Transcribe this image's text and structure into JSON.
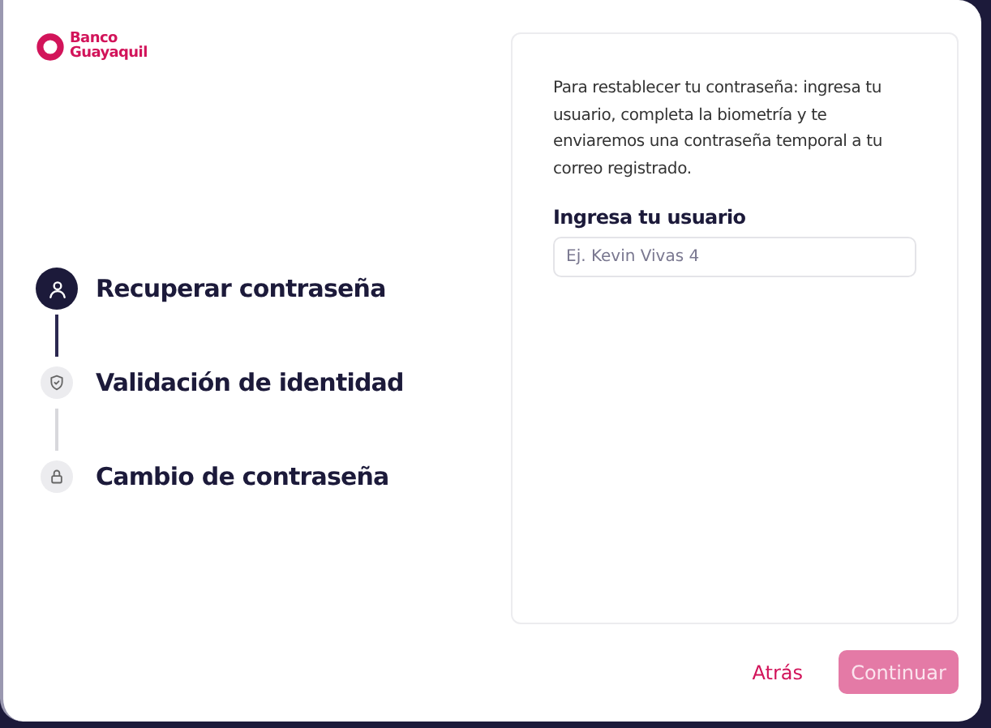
{
  "brand": {
    "line_1": "Banco",
    "line_2": "Guayaquil"
  },
  "steps": [
    {
      "label": "Recuperar contraseña",
      "kind": "user",
      "selected": true
    },
    {
      "label": "Validación de identidad",
      "kind": "shield",
      "selected": false
    },
    {
      "label": "Cambio de contraseña",
      "kind": "lock",
      "selected": false
    }
  ],
  "form": {
    "description": "Para restablecer tu contraseña: ingresa tu usuario, completa la biometría y te enviaremos una contraseña temporal a tu correo registrado.",
    "field_label": "Ingresa tu usuario",
    "placeholder": "Ej. Kevin Vivas 4"
  },
  "actions": {
    "back": "Atrás",
    "continue": "Continuar",
    "continue_disabled": true
  }
}
